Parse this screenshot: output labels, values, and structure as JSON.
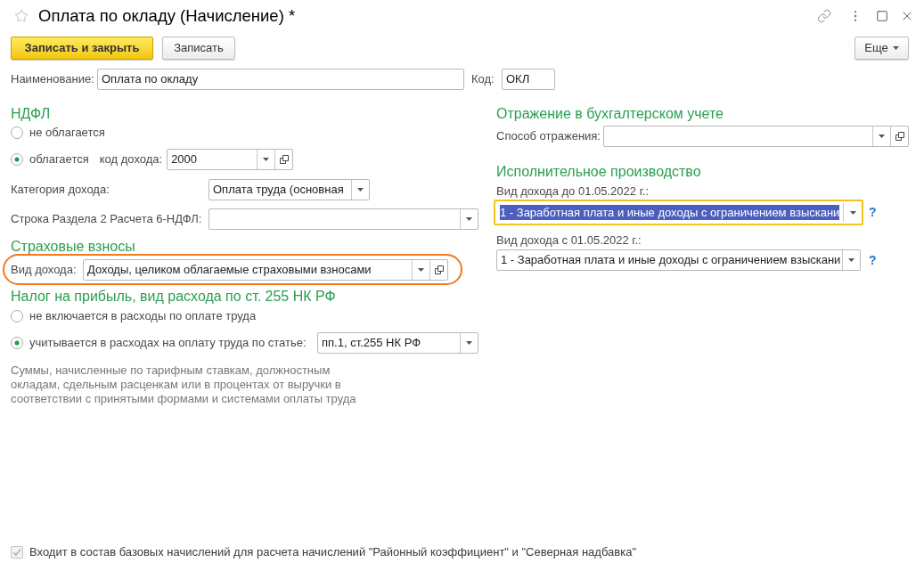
{
  "window": {
    "title": "Оплата по окладу (Начисление) *"
  },
  "toolbar": {
    "buttons": [
      {
        "label": "Записать и закрыть",
        "kind": "primary"
      },
      {
        "label": "Записать",
        "kind": "default"
      }
    ],
    "more_button": {
      "label": "Еще"
    }
  },
  "name_row": {
    "name": {
      "label": "Наименование:",
      "value": "Оплата по окладу"
    },
    "code": {
      "label": "Код:",
      "value": "ОКЛ"
    }
  },
  "ndfl": {
    "title": "НДФЛ",
    "options": [
      {
        "label": "не облагается",
        "selected": false
      },
      {
        "label": "облагается",
        "selected": true
      }
    ],
    "income_code": {
      "label": "код дохода:",
      "value": "2000"
    },
    "income_category": {
      "label": "Категория дохода:",
      "value": "Оплата труда (основная"
    },
    "report_line": {
      "label": "Строка Раздела 2 Расчета 6-НДФЛ:"
    }
  },
  "insurance": {
    "title": "Страховые взносы",
    "income_type": {
      "label": "Вид дохода:",
      "value": "Доходы, целиком облагаемые страховыми взносами"
    },
    "highlighted": true
  },
  "profit_tax": {
    "title": "Налог на прибыль, вид расхода по ст. 255 НК РФ",
    "options": [
      {
        "label": "не включается в расходы по оплате труда",
        "selected": false
      },
      {
        "label": "учитывается в расходах на оплату труда по статье:",
        "selected": true
      }
    ],
    "article": {
      "value": "пп.1, ст.255 НК РФ"
    },
    "note": "Суммы, начисленные по тарифным ставкам, должностным окладам, сдельным расценкам или в процентах от выручки в соответствии с принятыми формами и системами оплаты труда"
  },
  "accounting": {
    "title": "Отражение в бухгалтерском учете",
    "method": {
      "label": "Способ отражения:"
    }
  },
  "enforcement": {
    "title": "Исполнительное производство",
    "fields": [
      {
        "label": "Вид дохода до 01.05.2022 г.:",
        "value": "1 - Заработная плата и иные доходы с ограничением взыскани",
        "focused": true,
        "help": "?"
      },
      {
        "label": "Вид дохода с 01.05.2022 г.:",
        "value": "1 - Заработная плата и иные доходы с ограничением взыскани",
        "focused": false,
        "help": "?"
      }
    ]
  },
  "footer_checkbox": {
    "label": "Входит в состав базовых начислений для расчета начислений \"Районный коэффициент\" и \"Северная надбавка\"",
    "checked": true,
    "disabled": true
  }
}
